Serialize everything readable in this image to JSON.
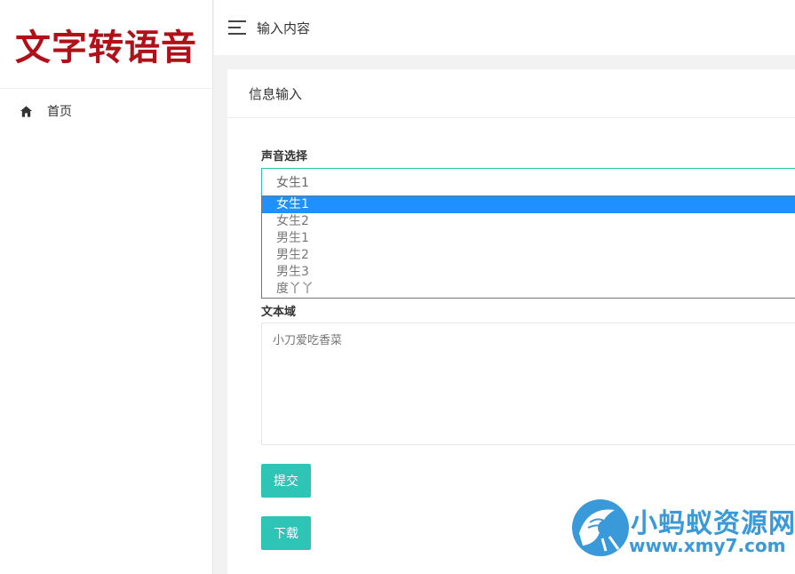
{
  "brand": {
    "logo_text": "文字转语音",
    "logo_color": "#b01018"
  },
  "sidebar": {
    "items": [
      {
        "label": "首页",
        "icon": "home-icon"
      }
    ]
  },
  "header": {
    "title": "输入内容"
  },
  "card": {
    "title": "信息输入"
  },
  "form": {
    "voice_label": "声音选择",
    "voice_selected": "女生1",
    "voice_options": [
      "女生1",
      "女生2",
      "男生1",
      "男生2",
      "男生3",
      "度丫丫"
    ],
    "textarea_label": "文本域",
    "textarea_value": "小刀爱吃香菜",
    "submit_label": "提交",
    "download_label": "下载"
  },
  "watermark": {
    "title": "小蚂蚁资源网",
    "url": "www.xmy7.com"
  },
  "colors": {
    "accent": "#2ec4b6",
    "dropdown_highlight": "#1e90ff",
    "focus_border": "#2ec4a0",
    "watermark": "#3a9ad9"
  }
}
